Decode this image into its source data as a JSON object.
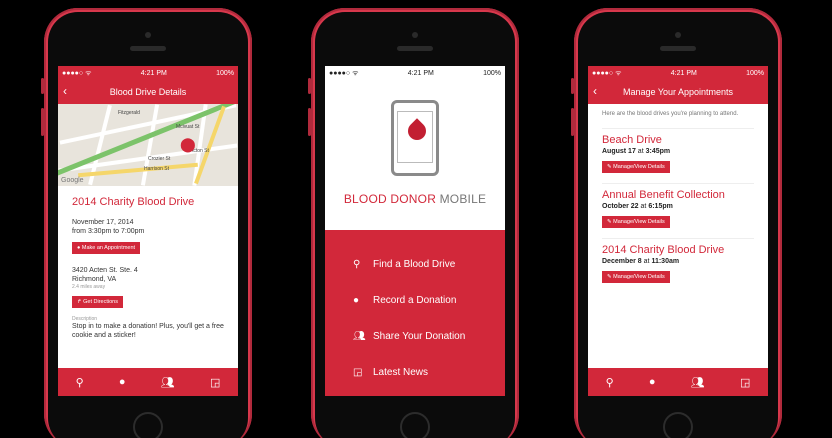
{
  "status": {
    "time": "4:21 PM",
    "battery": "100%"
  },
  "phone1": {
    "nav_title": "Blood Drive Details",
    "map": {
      "label1": "Mcivuat St",
      "label2": "Crozier St",
      "label3": "Harrison St",
      "label4": "Acton St",
      "label5": "Fitzgerald",
      "google": "Google"
    },
    "event_title": "2014 Charity Blood Drive",
    "date": "November 17, 2014",
    "time": "from 3:30pm to 7:00pm",
    "appointment_button": "Make an Appointment",
    "address_line1": "3420 Acten St. Ste. 4",
    "address_line2": "Richmond, VA",
    "distance": "2.4 miles away",
    "directions_button": "Get Directions",
    "description_label": "Description",
    "description": "Stop in to make a donation! Plus, you'll get a free cookie and a sticker!"
  },
  "phone2": {
    "brand_main": "BLOOD DONOR",
    "brand_suffix": " MOBILE",
    "menu": [
      {
        "label": "Find a Blood Drive",
        "icon": "search-icon"
      },
      {
        "label": "Record a Donation",
        "icon": "drop-icon"
      },
      {
        "label": "Share Your Donation",
        "icon": "users-icon"
      },
      {
        "label": "Latest News",
        "icon": "rss-icon"
      }
    ]
  },
  "phone3": {
    "nav_title": "Manage Your Appointments",
    "intro": "Here are the blood drives you're planning to attend.",
    "appointments": [
      {
        "name": "Beach Drive",
        "date": "August 17",
        "at": "at",
        "time": "3:45pm",
        "button": "Manage/View Details"
      },
      {
        "name": "Annual Benefit Collection",
        "date": "October 22",
        "at": "at",
        "time": "6:15pm",
        "button": "Manage/View Details"
      },
      {
        "name": "2014 Charity Blood Drive",
        "date": "December 8",
        "at": "at",
        "time": "11:30am",
        "button": "Manage/View Details"
      }
    ]
  },
  "tabbar": {
    "icons": [
      "search-icon",
      "drop-icon",
      "users-icon",
      "rss-icon"
    ]
  },
  "colors": {
    "accent": "#d2283a",
    "phone_body": "#d8384c"
  }
}
